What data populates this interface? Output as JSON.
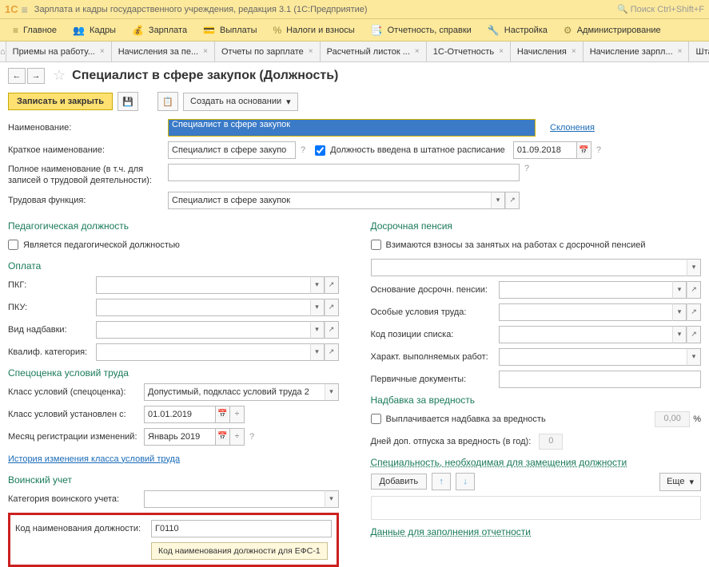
{
  "app": {
    "title": "Зарплата и кадры государственного учреждения, редакция 3.1 (1С:Предприятие)",
    "search_placeholder": "Поиск Ctrl+Shift+F"
  },
  "menu": {
    "main": "Главное",
    "staff": "Кадры",
    "salary": "Зарплата",
    "payments": "Выплаты",
    "taxes": "Налоги и взносы",
    "reports": "Отчетность, справки",
    "settings": "Настройка",
    "admin": "Администрирование"
  },
  "tabs": {
    "t1": "Приемы на работу...",
    "t2": "Начисления за пе...",
    "t3": "Отчеты по зарплате",
    "t4": "Расчетный листок ...",
    "t5": "1С-Отчетность",
    "t6": "Начисления",
    "t7": "Начисление зарпл...",
    "t8": "Штатное расписание"
  },
  "header": {
    "title": "Специалист в сфере закупок (Должность)"
  },
  "toolbar": {
    "save_close": "Записать и закрыть",
    "create_based": "Создать на основании"
  },
  "labels": {
    "name": "Наименование:",
    "short_name": "Краткое наименование:",
    "full_name": "Полное наименование (в т.ч. для записей о трудовой деятельности):",
    "labor_func": "Трудовая функция:",
    "declensions": "Склонения",
    "in_schedule": "Должность введена в штатное расписание",
    "sec_ped": "Педагогическая должность",
    "is_ped": "Является педагогической должностью",
    "sec_pay": "Оплата",
    "pkg": "ПКГ:",
    "pku": "ПКУ:",
    "allowance_type": "Вид надбавки:",
    "qualif": "Квалиф. категория:",
    "sec_spec": "Спецоценка условий труда",
    "class_spec": "Класс условий (спецоценка):",
    "class_from": "Класс условий установлен с:",
    "reg_month": "Месяц регистрации изменений:",
    "history": "История изменения класса условий труда",
    "sec_mil": "Воинский учет",
    "mil_cat": "Категория воинского учета:",
    "code_pos": "Код наименования должности:",
    "tooltip": "Код наименования должности для ЕФС-1",
    "sec_early": "Досрочная пенсия",
    "early_contrib": "Взимаются взносы за занятых на работах с досрочной пенсией",
    "early_basis": "Основание досрочн. пенсии:",
    "special_cond": "Особые условия труда:",
    "list_pos_code": "Код позиции списка:",
    "work_nature": "Характ. выполняемых работ:",
    "primary_docs": "Первичные документы:",
    "sec_hazard": "Надбавка за вредность",
    "hazard_paid": "Выплачивается надбавка за вредность",
    "extra_days": "Дней доп. отпуска за вредность (в год):",
    "sec_specialty": "Специальность, необходимая для замещения должности",
    "add": "Добавить",
    "more": "Еще",
    "sec_report": "Данные для заполнения отчетности"
  },
  "values": {
    "name": "Специалист в сфере закупок",
    "short_name": "Специалист в сфере закупо",
    "labor_func": "Специалист в сфере закупок",
    "schedule_date": "01.09.2018",
    "class_spec": "Допустимый, подкласс условий труда 2",
    "class_from": "01.01.2019",
    "reg_month": "Январь 2019",
    "code_pos": "Г0110",
    "hazard_amount": "0,00",
    "extra_days": "0",
    "percent": "%"
  }
}
